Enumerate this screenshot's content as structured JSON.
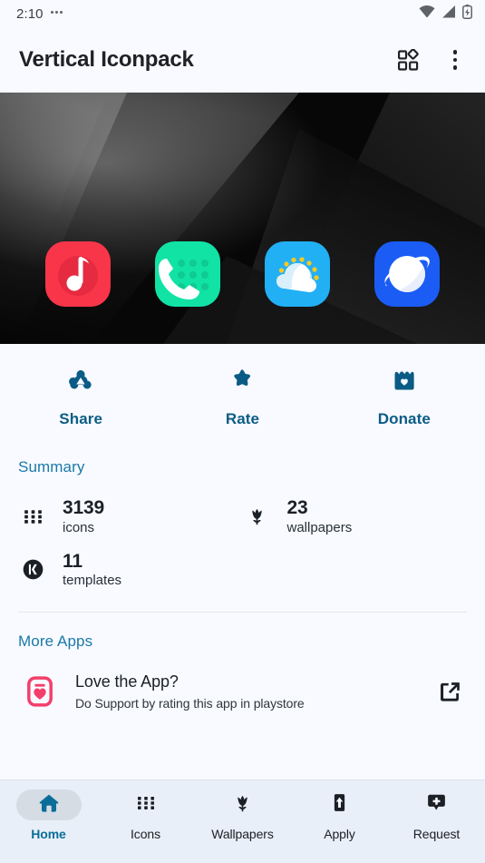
{
  "status_bar": {
    "time": "2:10",
    "notification_dots_icon": "overflow-dots-icon",
    "icons": [
      "wifi-icon",
      "cellular-signal-icon",
      "battery-charging-icon"
    ]
  },
  "app_bar": {
    "title": "Vertical Iconpack",
    "grid_action_icon": "dashboard-grid-icon",
    "overflow_action_icon": "kebab-menu-icon"
  },
  "hero": {
    "background_style": "dark-abstract-wallpaper",
    "preview_icons": [
      {
        "name": "music-app-icon",
        "label": "Music",
        "color": "#F93549"
      },
      {
        "name": "phone-dialer-app-icon",
        "label": "Phone",
        "color": "#11E3A5"
      },
      {
        "name": "weather-app-icon",
        "label": "Weather",
        "color": "#22B0F5"
      },
      {
        "name": "browser-app-icon",
        "label": "Internet",
        "color": "#1B5CF5"
      }
    ]
  },
  "actions": [
    {
      "label": "Share",
      "icon": "share-nodes-icon"
    },
    {
      "label": "Rate",
      "icon": "star-icon"
    },
    {
      "label": "Donate",
      "icon": "gift-heart-icon"
    }
  ],
  "summary": {
    "title": "Summary",
    "stats": [
      {
        "value": "3139",
        "label": "icons",
        "icon": "grid-dots-icon"
      },
      {
        "value": "23",
        "label": "wallpapers",
        "icon": "tulip-icon"
      },
      {
        "value": "11",
        "label": "templates",
        "icon": "kwgt-circle-icon"
      }
    ]
  },
  "more_apps": {
    "title": "More Apps",
    "cards": [
      {
        "title": "Love the App?",
        "subtitle": "Do Support by rating this app in playstore",
        "icon": "heart-card-icon",
        "action_icon": "open-external-icon"
      }
    ]
  },
  "bottom_nav": {
    "items": [
      {
        "label": "Home",
        "icon": "home-icon",
        "active": true
      },
      {
        "label": "Icons",
        "icon": "grid-dots-icon",
        "active": false
      },
      {
        "label": "Wallpapers",
        "icon": "tulip-icon",
        "active": false
      },
      {
        "label": "Apply",
        "icon": "apply-arrow-icon",
        "active": false
      },
      {
        "label": "Request",
        "icon": "request-plus-icon",
        "active": false
      }
    ]
  },
  "colors": {
    "accent": "#0B6E99",
    "section_title": "#1B79A8",
    "background": "#F8FAFF",
    "nav_background": "#E9EFF8",
    "text_primary": "#1B2026"
  }
}
